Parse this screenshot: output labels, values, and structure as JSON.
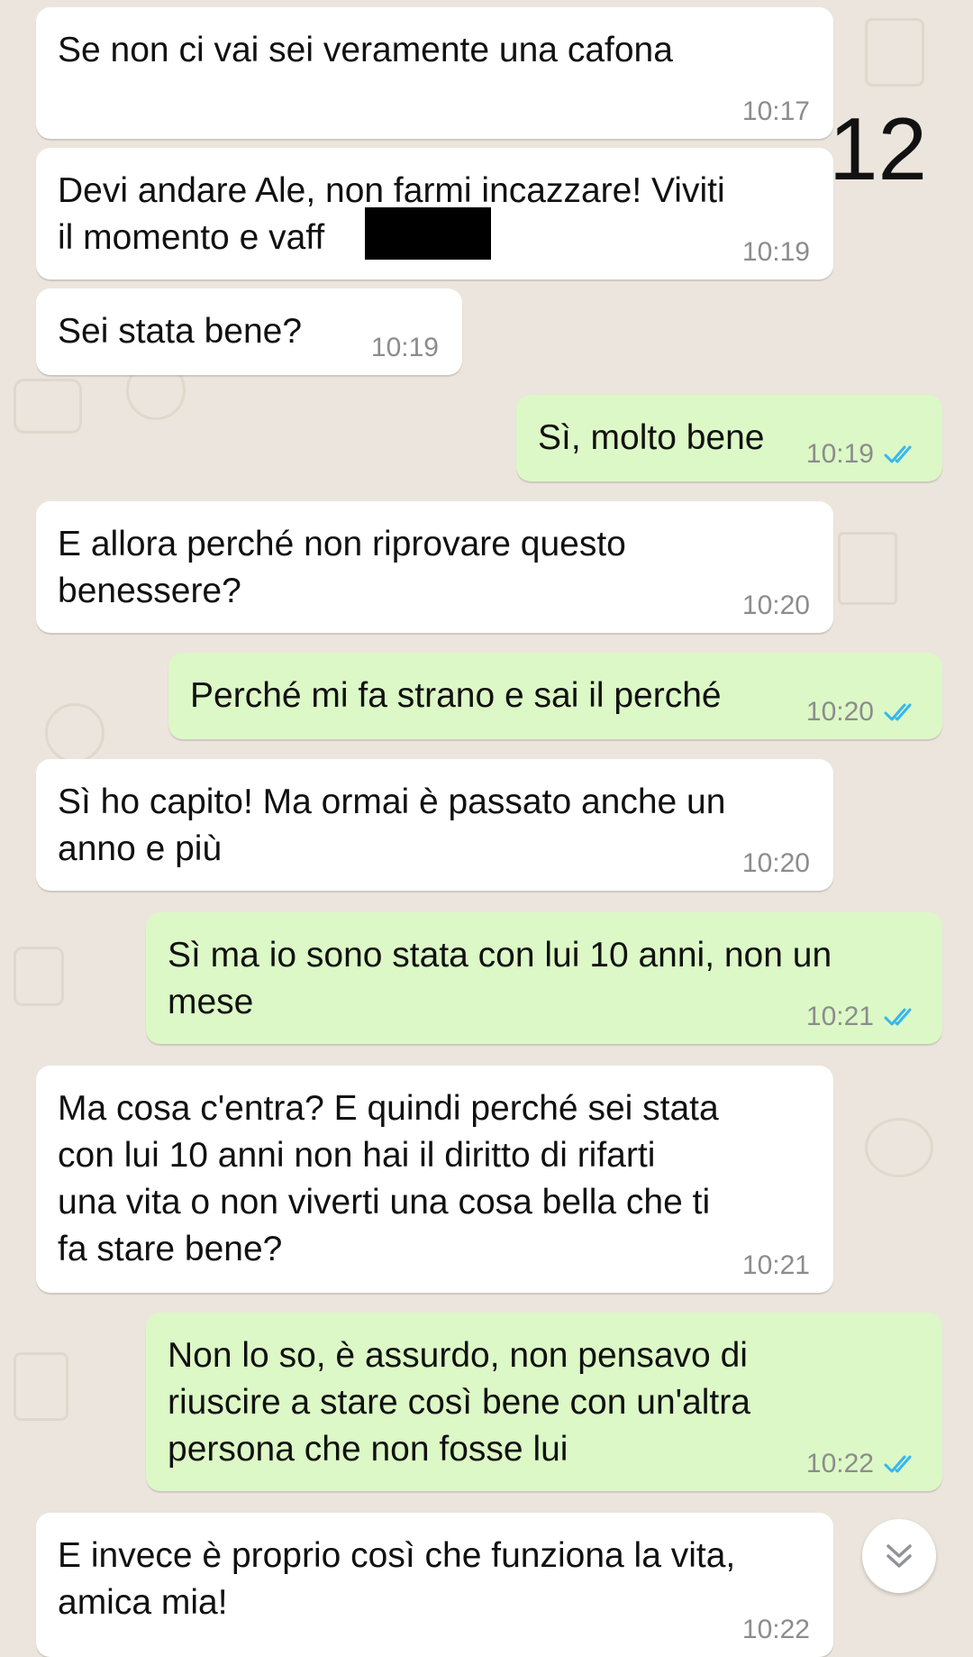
{
  "chat": {
    "messages": [
      {
        "direction": "incoming",
        "text": "Se non ci vai sei veramente una cafona",
        "time": "10:17"
      },
      {
        "direction": "incoming",
        "text": "Devi andare Ale, non farmi incazzare! Viviti\nil momento e vaff",
        "time": "10:19"
      },
      {
        "direction": "incoming",
        "text": "Sei stata bene?",
        "time": "10:19"
      },
      {
        "direction": "outgoing",
        "text": "Sì, molto bene",
        "time": "10:19",
        "status": "read"
      },
      {
        "direction": "incoming",
        "text": "E allora perché non riprovare questo\nbenessere?",
        "time": "10:20"
      },
      {
        "direction": "outgoing",
        "text": "Perché mi fa strano e sai il perché",
        "time": "10:20",
        "status": "read"
      },
      {
        "direction": "incoming",
        "text": "Sì ho capito! Ma ormai è passato anche un\nanno e più",
        "time": "10:20"
      },
      {
        "direction": "outgoing",
        "text": "Sì ma io sono stata con lui 10 anni, non un\nmese",
        "time": "10:21",
        "status": "read"
      },
      {
        "direction": "incoming",
        "text": "Ma cosa c'entra? E quindi perché sei stata\ncon lui 10 anni non hai il diritto di rifarti\nuna vita o non viverti una cosa bella che ti\nfa stare bene?",
        "time": "10:21"
      },
      {
        "direction": "outgoing",
        "text": "Non lo so, è assurdo, non pensavo di\nriuscire a stare così bene con un'altra\npersona che non fosse lui",
        "time": "10:22",
        "status": "read"
      },
      {
        "direction": "incoming",
        "text": "E invece è proprio così che funziona la vita,\namica mia!",
        "time": "10:22"
      }
    ]
  },
  "overlay": {
    "page_number": "12"
  },
  "colors": {
    "incoming_bubble": "#FFFFFF",
    "outgoing_bubble": "#DCF8C6",
    "read_ticks": "#34B7F1",
    "wallpaper": "#ECE5DD"
  },
  "icons": {
    "read_status": "double-check-icon",
    "scroll_down": "chevron-double-down-icon"
  }
}
